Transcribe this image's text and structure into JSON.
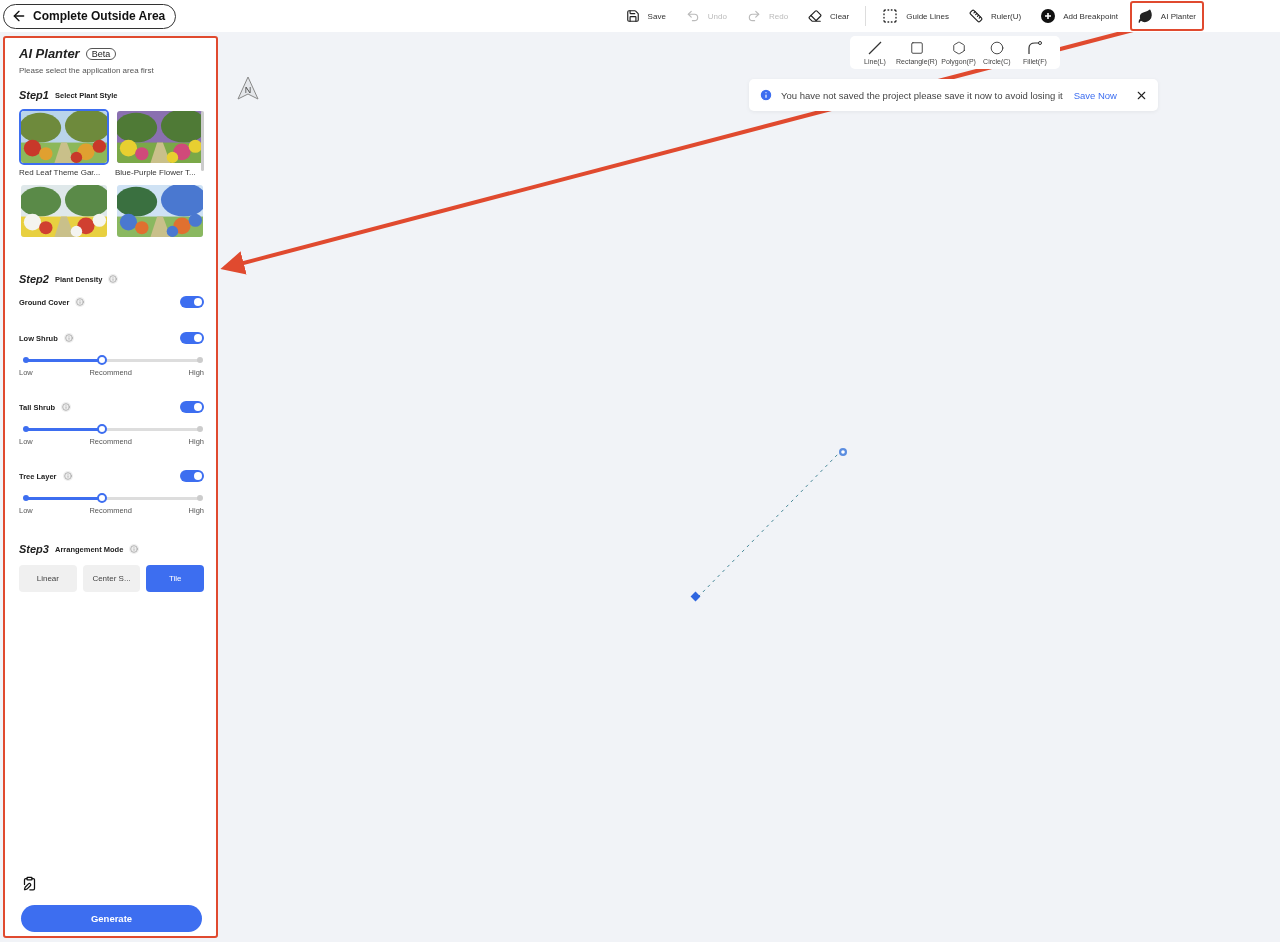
{
  "header": {
    "back_button": "Complete Outside Area"
  },
  "toolbar": [
    {
      "label": "Save",
      "disabled": false,
      "highlighted": false
    },
    {
      "label": "Undo",
      "disabled": true,
      "highlighted": false
    },
    {
      "label": "Redo",
      "disabled": true,
      "highlighted": false
    },
    {
      "label": "Clear",
      "disabled": false,
      "highlighted": false
    },
    {
      "label": "Guide Lines",
      "disabled": false,
      "highlighted": false
    },
    {
      "label": "Ruler(U)",
      "disabled": false,
      "highlighted": false
    },
    {
      "label": "Add Breakpoint",
      "disabled": false,
      "highlighted": false
    },
    {
      "label": "AI Planter",
      "disabled": false,
      "highlighted": true
    }
  ],
  "draw_tools": [
    {
      "label": "Line(L)"
    },
    {
      "label": "Rectangle(R)"
    },
    {
      "label": "Polygon(P)"
    },
    {
      "label": "Circle(C)"
    },
    {
      "label": "Fillet(F)"
    }
  ],
  "toast": {
    "message": "You have not saved the project please save it now to avoid losing it",
    "action": "Save Now"
  },
  "compass": "N",
  "panel": {
    "highlighted": true,
    "title": "AI Planter",
    "badge": "Beta",
    "hint": "Please select the application area first",
    "step1": {
      "step": "Step1",
      "title": "Select Plant Style",
      "styles": [
        {
          "kind": "picture",
          "caption": "Red Leaf Theme Gar...",
          "selected": true
        },
        {
          "kind": "picture",
          "caption": "Blue-Purple Flower T...",
          "selected": false
        },
        {
          "kind": "picture",
          "selected": false
        },
        {
          "kind": "picture",
          "selected": false
        }
      ]
    },
    "step2": {
      "step": "Step2",
      "title": "Plant Density",
      "layers": [
        {
          "name": "Ground Cover",
          "on": true
        },
        {
          "name": "Low Shrub",
          "on": true,
          "level": 0.44,
          "low": "Low",
          "mid": "Recommend",
          "high": "High"
        },
        {
          "name": "Tall Shrub",
          "on": true,
          "level": 0.44,
          "low": "Low",
          "mid": "Recommend",
          "high": "High"
        },
        {
          "name": "Tree Layer",
          "on": true,
          "level": 0.44,
          "low": "Low",
          "mid": "Recommend",
          "high": "High"
        }
      ]
    },
    "step3": {
      "step": "Step3",
      "title": "Arrangement Mode",
      "modes": [
        {
          "label": "Linear",
          "selected": false
        },
        {
          "label": "Center S...",
          "selected": false
        },
        {
          "label": "Tile",
          "selected": true
        }
      ]
    },
    "generate": "Generate"
  }
}
